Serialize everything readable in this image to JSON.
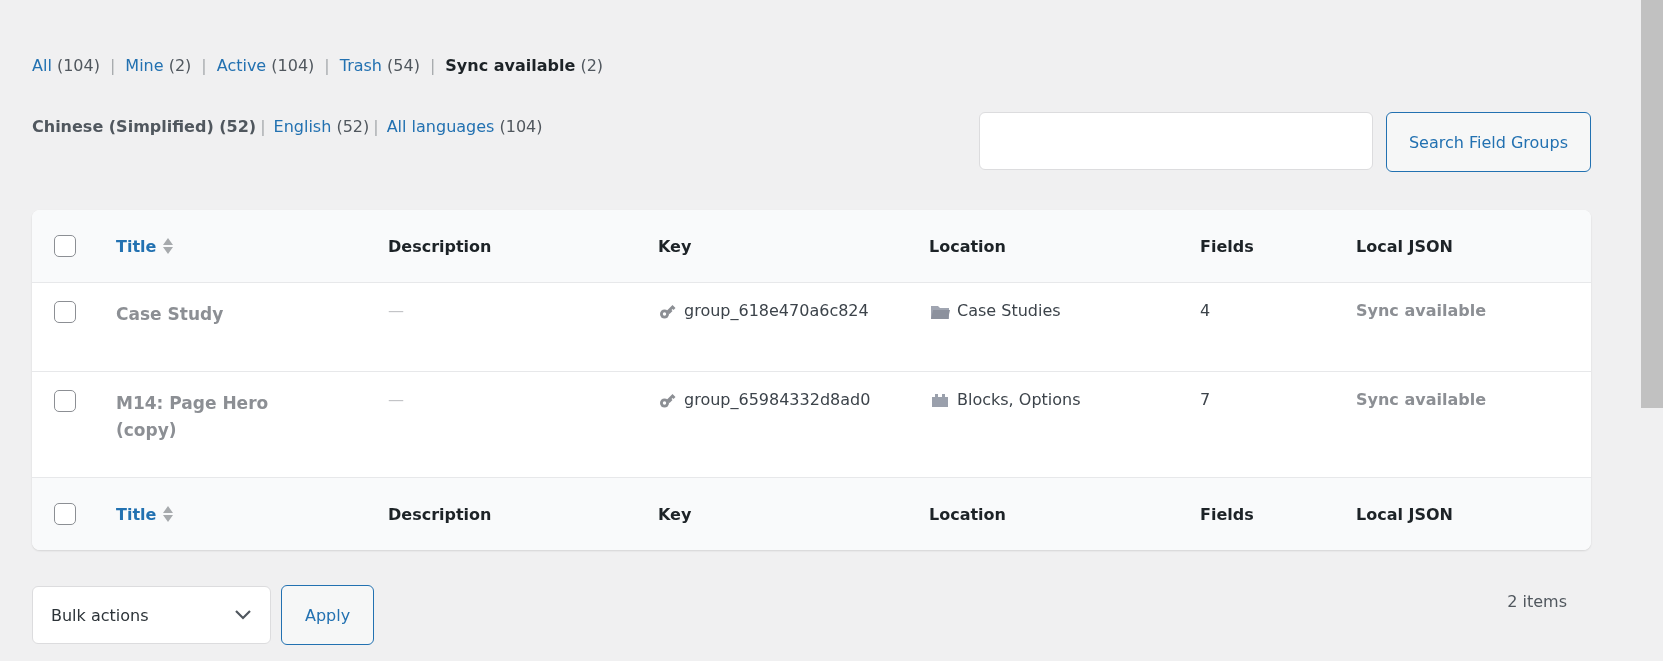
{
  "status_filters": [
    {
      "label": "All",
      "count": "(104)",
      "selected": false
    },
    {
      "separator": "|",
      "label": "Mine",
      "count": "(2)",
      "selected": false
    },
    {
      "separator": "|",
      "label": "Active",
      "count": "(104)",
      "selected": false
    },
    {
      "separator": "|",
      "label": "Trash",
      "count": "(54)",
      "selected": false
    },
    {
      "separator": "|",
      "label": "Sync available",
      "count": "(2)",
      "selected": true
    }
  ],
  "language_filters": [
    {
      "label": "Chinese (Simplified)",
      "count": "(52)",
      "selected": true
    },
    {
      "separator": "|",
      "label": "English",
      "count": "(52)",
      "selected": false
    },
    {
      "separator": "|",
      "label": "All languages",
      "count": "(104)",
      "selected": false
    }
  ],
  "search": {
    "button": "Search Field Groups"
  },
  "table": {
    "columns": [
      "Title",
      "Description",
      "Key",
      "Location",
      "Fields",
      "Local JSON"
    ],
    "select_all_checked": false,
    "rows": [
      {
        "checked": false,
        "title": "Case Study",
        "description": "—",
        "key": "group_618e470a6c824",
        "location": {
          "kind": "folder",
          "text": "Case Studies"
        },
        "fields": "4",
        "local_json": "Sync available"
      },
      {
        "checked": false,
        "title": "M14: Page Hero (copy)",
        "description": "—",
        "key": "group_65984332d8ad0",
        "location": {
          "kind": "block",
          "text": "Blocks, Options"
        },
        "fields": "7",
        "local_json": "Sync available"
      }
    ],
    "footer_columns": [
      "Title",
      "Description",
      "Key",
      "Location",
      "Fields",
      "Local JSON"
    ],
    "footer_select_all_checked": false
  },
  "bulk_actions": {
    "label": "Bulk actions",
    "button": "Apply"
  },
  "item_count": "2 items"
}
